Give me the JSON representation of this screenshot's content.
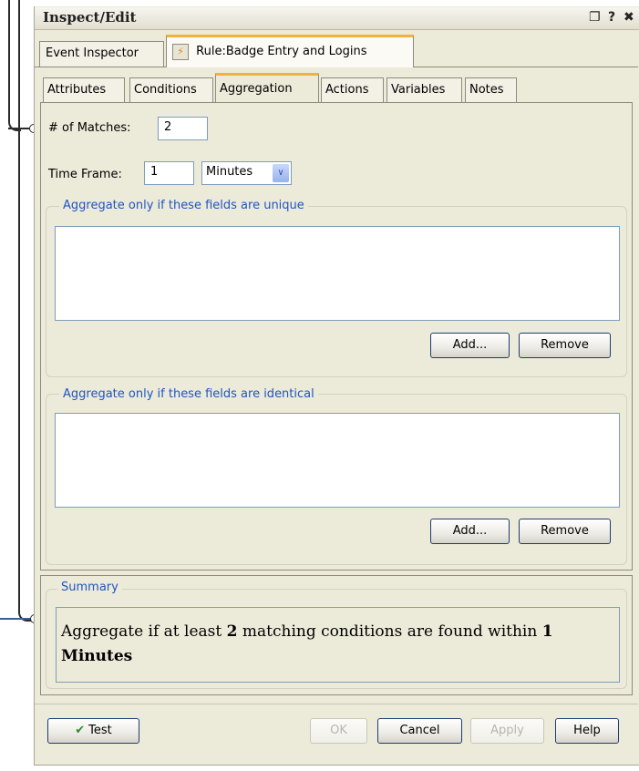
{
  "window": {
    "title": "Inspect/Edit",
    "controls": [
      "restore-icon",
      "help-icon",
      "close-icon"
    ],
    "restore_glyph": "❐",
    "help_glyph": "?",
    "close_glyph": "✖"
  },
  "tabs": [
    {
      "label": "Event Inspector",
      "active": false
    },
    {
      "label": "Rule:Badge Entry and Logins",
      "active": true,
      "icon": "rule-icon",
      "icon_glyph": "⚡"
    }
  ],
  "subtabs": [
    {
      "label": "Attributes"
    },
    {
      "label": "Conditions"
    },
    {
      "label": "Aggregation",
      "active": true
    },
    {
      "label": "Actions"
    },
    {
      "label": "Variables"
    },
    {
      "label": "Notes"
    }
  ],
  "aggregation": {
    "matches_label": "# of Matches:",
    "matches_value": "2",
    "timeframe_label": "Time Frame:",
    "timeframe_value": "1",
    "timeframe_unit": "Minutes",
    "dropdown_glyph": "∨",
    "unique_group": {
      "legend": "Aggregate only if these fields are unique",
      "add_label": "Add...",
      "remove_label": "Remove"
    },
    "identical_group": {
      "legend": "Aggregate only if these fields are identical",
      "add_label": "Add...",
      "remove_label": "Remove"
    }
  },
  "summary": {
    "legend": "Summary",
    "text_prefix": "Aggregate if at least ",
    "count": "2",
    "text_middle": " matching conditions are found within ",
    "amount": "1",
    "unit": "Minutes"
  },
  "buttons": {
    "test_label": "Test",
    "test_icon_glyph": "✔",
    "ok_label": "OK",
    "cancel_label": "Cancel",
    "apply_label": "Apply",
    "help_label": "Help"
  },
  "colors": {
    "panel_bg": "#ecead9",
    "active_tab_accent": "#f4b13a",
    "legend_text": "#1f55c3",
    "input_border": "#7f9db9"
  }
}
